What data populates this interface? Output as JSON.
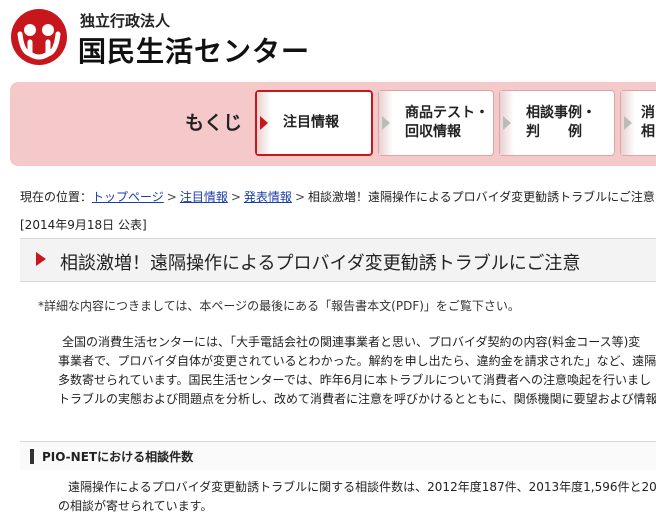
{
  "header": {
    "org_type": "独立行政法人",
    "org_name": "国民生活センター"
  },
  "nav": {
    "title": "もくじ",
    "tabs": [
      {
        "label_line1": "注目情報",
        "label_line2": ""
      },
      {
        "label_line1": "商品テスト・",
        "label_line2": "回収情報"
      },
      {
        "label_line1": "相談事例・",
        "label_line2": "判　　例"
      },
      {
        "label_line1": "消",
        "label_line2": "相"
      }
    ]
  },
  "breadcrumb": {
    "prefix": "現在の位置：",
    "items": [
      "トップページ",
      "注目情報",
      "発表情報"
    ],
    "current": "相談激増！遠隔操作によるプロバイダ変更勧誘トラブルにご注意"
  },
  "pubdate": "[2014年9月18日 公表]",
  "article": {
    "title": "相談激増！遠隔操作によるプロバイダ変更勧誘トラブルにご注意",
    "note": "*詳細な内容につきましては、本ページの最後にある「報告書本文(PDF)」をご覧下さい。",
    "paragraph_lines": [
      "全国の消費生活センターには、「大手電話会社の関連事業者と思い、プロバイダ契約の内容(料金コース等)変",
      "事業者で、プロバイダ自体が変更されているとわかった。解約を申し出たら、違約金を請求された」など、遠隔操作",
      "多数寄せられています。国民生活センターでは、昨年6月に本トラブルについて消費者への注意喚起を行いまし",
      "トラブルの実態および問題点を分析し、改めて消費者に注意を呼びかけるとともに、関係機関に要望および情報"
    ],
    "section_heading": "PIO-NETにおける相談件数",
    "section_lines": [
      "遠隔操作によるプロバイダ変更勧誘トラブルに関する相談件数は、2012年度187件、2013年度1,596件と2013年",
      "の相談が寄せられています。"
    ]
  },
  "colors": {
    "brand_red": "#c8161d",
    "nav_band": "#f5c9c9",
    "link_blue": "#1a3fa8"
  }
}
